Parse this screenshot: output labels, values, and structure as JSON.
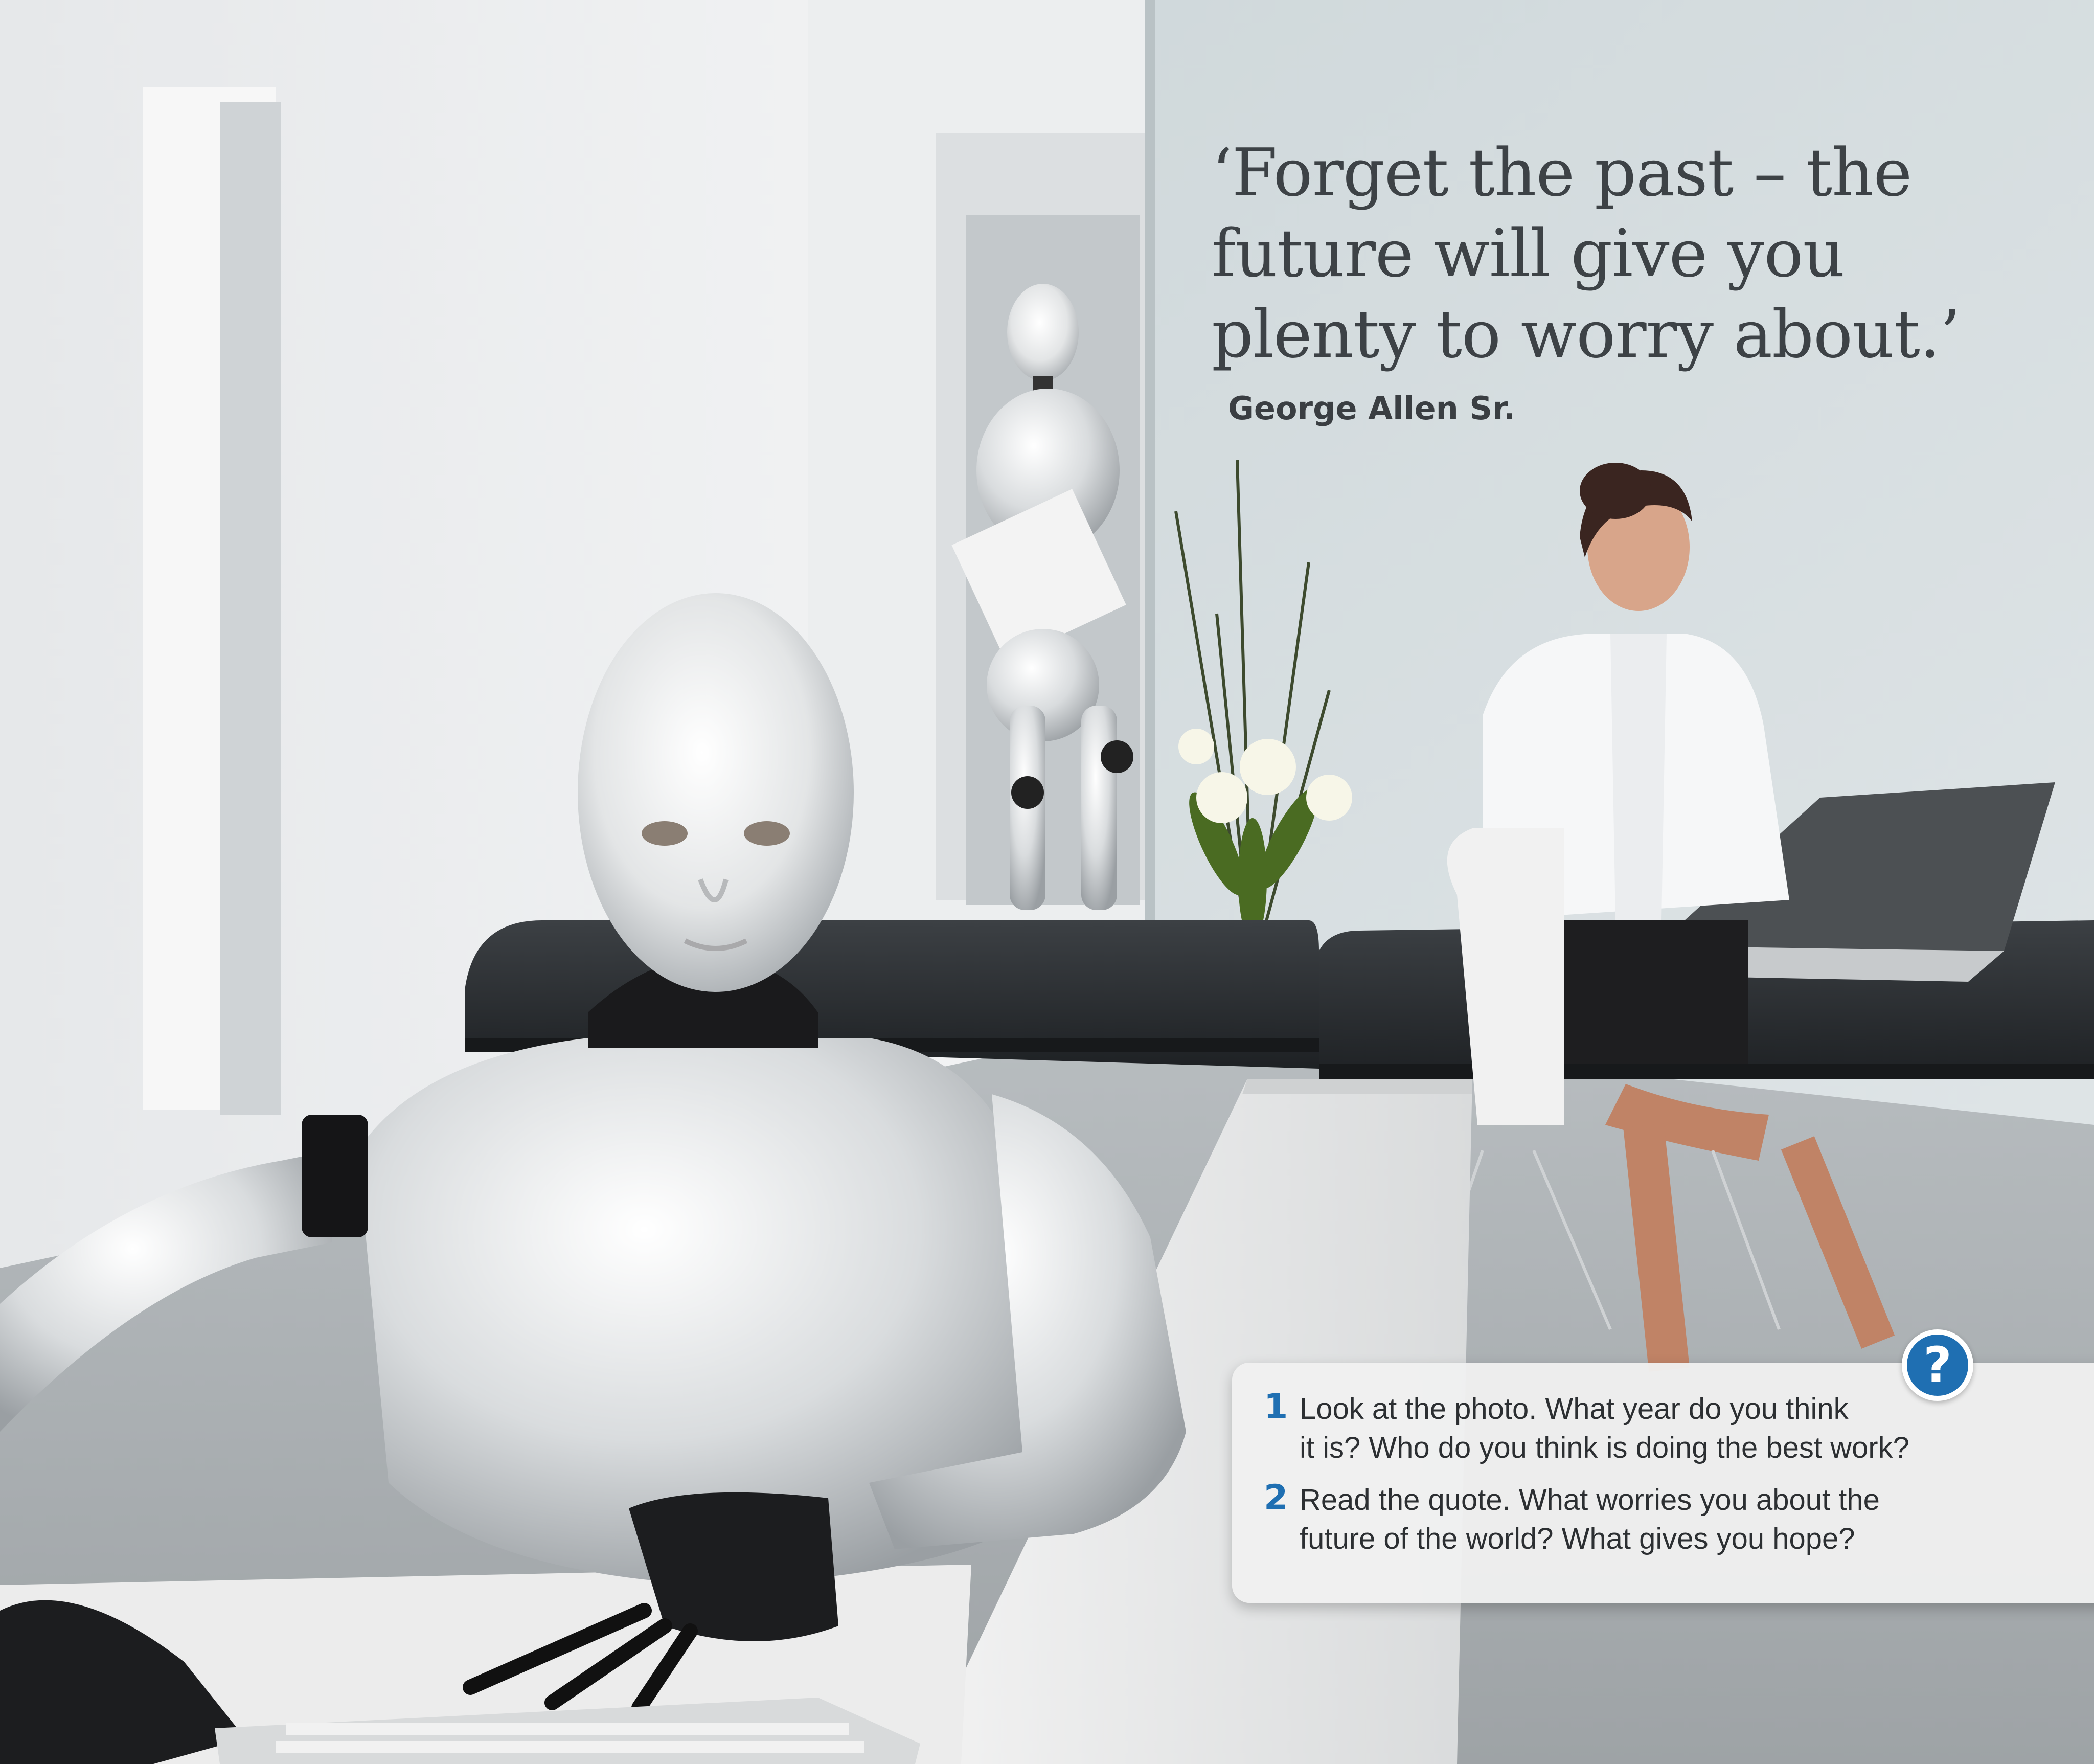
{
  "quote": {
    "text": "‘Forget the past – the\nfuture will give you\nplenty to worry about.’",
    "author": "George Allen Sr."
  },
  "questions": [
    {
      "number": "1",
      "text": "Look at the photo. What year do you think\nit is? Who do you think is doing the best work?"
    },
    {
      "number": "2",
      "text": "Read the quote. What worries you about the\nfuture of the world? What gives you hope?"
    }
  ],
  "help_badge": {
    "symbol": "?",
    "icon": "question-mark-icon"
  },
  "colors": {
    "accent": "#1f6fb2",
    "quote_text": "#3d4246",
    "panel": "#f0f0f0"
  }
}
